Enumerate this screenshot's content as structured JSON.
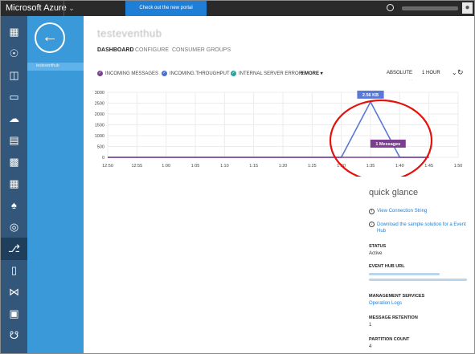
{
  "topbar": {
    "brand": "Microsoft Azure",
    "portal_button": "Check out the new portal"
  },
  "sidebar": {
    "icons": [
      "grid-icon",
      "globe-icon",
      "monitor-icon",
      "mobile-icon",
      "cloud-services-icon",
      "sql-icon",
      "db-icon",
      "table-icon",
      "hdinsight-icon",
      "media-icon",
      "service-bus-icon",
      "mobile-services-icon",
      "visual-studio-icon",
      "cache-icon",
      "network-icon",
      "storage-icon"
    ]
  },
  "page": {
    "title": "testeventhub",
    "tabs": [
      "DASHBOARD",
      "CONFIGURE",
      "CONSUMER GROUPS"
    ],
    "active_tab": "DASHBOARD"
  },
  "metrics": {
    "items": [
      {
        "label": "INCOMING MESSAGES",
        "color": "#7b3f8f"
      },
      {
        "label": "INCOMING.THROUGHPUT",
        "color": "#4a6fd1"
      },
      {
        "label": "INTERNAL SERVER ERRORS",
        "color": "#2aa4a0"
      }
    ],
    "more": "6 MORE",
    "scale": "ABSOLUTE",
    "range": "1 HOUR"
  },
  "chart_data": {
    "type": "line",
    "y_ticks": [
      "3000",
      "2500",
      "2000",
      "1500",
      "1000",
      "500",
      "0"
    ],
    "ylim": [
      0,
      3000
    ],
    "x_ticks": [
      "12:50",
      "12:55",
      "1:00",
      "1:05",
      "1:10",
      "1:15",
      "1:20",
      "1:25",
      "1:30",
      "1:35",
      "1:40",
      "1:45",
      "1:50"
    ],
    "series": [
      {
        "color": "#5a78d6",
        "x": [
          "12:50",
          "1:25",
          "1:30",
          "1:35",
          "1:40",
          "1:45"
        ],
        "values": [
          0,
          0,
          0,
          2560,
          0,
          0
        ]
      },
      {
        "color": "#7b3f8f",
        "x": [
          "12:50",
          "1:45"
        ],
        "values": [
          0,
          0
        ]
      }
    ],
    "annotations": [
      {
        "text": "2.56 KB",
        "x": "1:35",
        "y": 2560,
        "color": "#5a78d6"
      },
      {
        "text": "1 Messages",
        "x": "1:38",
        "y": 300,
        "color": "#7b3f8f"
      }
    ],
    "highlight_color": "#e3120b"
  },
  "quick_glance": {
    "title": "quick glance",
    "links": [
      "View Connection String",
      "Download the sample solution for a Event Hub"
    ],
    "status_label": "STATUS",
    "status_value": "Active",
    "url_label": "EVENT HUB URL",
    "management_label": "MANAGEMENT SERVICES",
    "management_link": "Operation Logs",
    "retention_label": "MESSAGE RETENTION",
    "retention_value": "1",
    "partition_label": "PARTITION COUNT",
    "partition_value": "4"
  }
}
